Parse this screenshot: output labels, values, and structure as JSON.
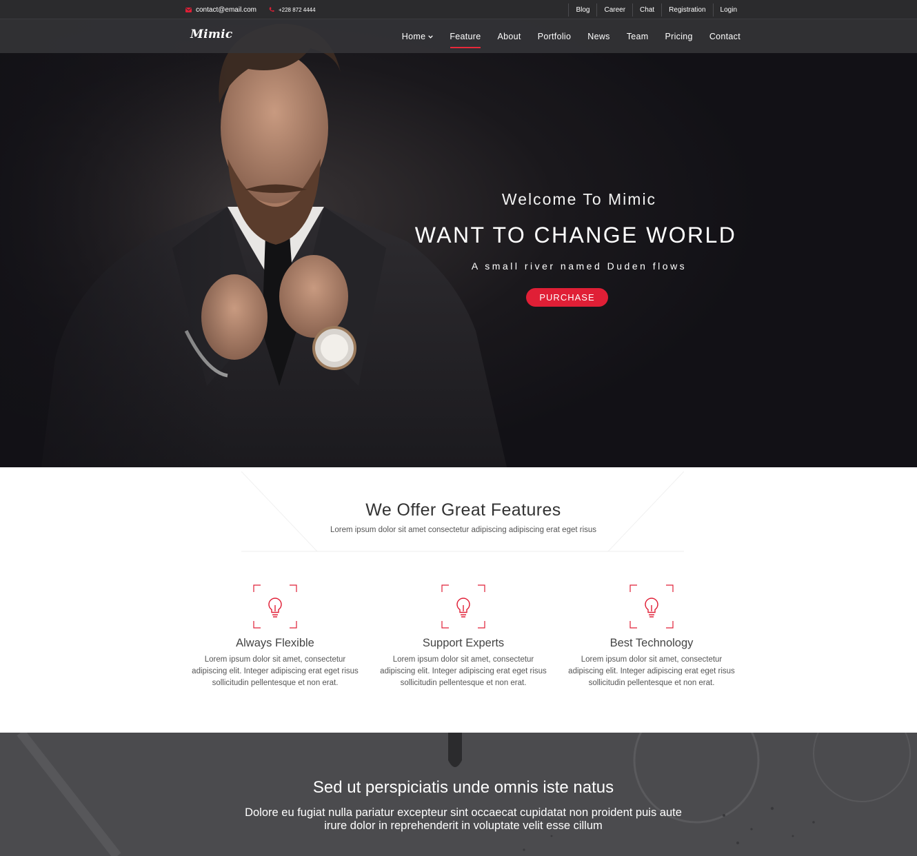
{
  "topbar": {
    "email": "contact@email.com",
    "phone": "+228 872 4444",
    "links": [
      "Blog",
      "Career",
      "Chat",
      "Registration",
      "Login"
    ]
  },
  "nav": {
    "logo": "Mimic",
    "items": [
      "Home",
      "Feature",
      "About",
      "Portfolio",
      "News",
      "Team",
      "Pricing",
      "Contact"
    ],
    "active": "Feature"
  },
  "hero": {
    "welcome": "Welcome To Mimic",
    "headline": "WANT TO CHANGE WORLD",
    "subheadline": "A small river named Duden flows",
    "button": "PURCHASE"
  },
  "features": {
    "title": "We Offer Great Features",
    "tagline": "Lorem ipsum dolor sit amet consectetur adipiscing adipiscing erat eget risus",
    "items": [
      {
        "title": "Always Flexible",
        "text": "Lorem ipsum dolor sit amet, consectetur adipiscing elit. Integer adipiscing erat eget risus sollicitudin pellentesque et non erat.",
        "icon": "lightbulb-icon"
      },
      {
        "title": "Support Experts",
        "text": "Lorem ipsum dolor sit amet, consectetur adipiscing elit. Integer adipiscing erat eget risus sollicitudin pellentesque et non erat.",
        "icon": "lightbulb-icon"
      },
      {
        "title": "Best Technology",
        "text": "Lorem ipsum dolor sit amet, consectetur adipiscing elit. Integer adipiscing erat eget risus sollicitudin pellentesque et non erat.",
        "icon": "lightbulb-icon"
      }
    ]
  },
  "band": {
    "title": "Sed ut perspiciatis unde omnis iste natus",
    "text": "Dolore eu fugiat nulla pariatur excepteur sint occaecat cupidatat non proident puis aute irure dolor in reprehenderit in voluptate velit esse cillum"
  },
  "colors": {
    "accent": "#e01f36",
    "topbar": "#2b2b2d",
    "hero_bg": "#121116"
  }
}
